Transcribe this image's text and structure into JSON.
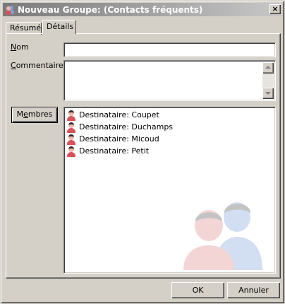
{
  "window": {
    "title": "Nouveau Groupe:  (Contacts fréquents)",
    "close_label": "×"
  },
  "tabs": [
    {
      "label": "Résumé"
    },
    {
      "label": "Détails"
    }
  ],
  "fields": {
    "nom": {
      "label_accel": "N",
      "label_rest": "om",
      "value": ""
    },
    "commentaires": {
      "label_accel": "C",
      "label_rest": "ommentaires",
      "value": ""
    }
  },
  "members": {
    "button_pre": "M",
    "button_accel": "e",
    "button_rest": "mbres",
    "items": [
      {
        "label": "Destinataire: Coupet"
      },
      {
        "label": "Destinataire: Duchamps"
      },
      {
        "label": "Destinataire: Micoud"
      },
      {
        "label": "Destinataire: Petit"
      }
    ]
  },
  "footer": {
    "ok_label": "OK",
    "cancel_label": "Annuler"
  },
  "icons": {
    "app": "group-icon",
    "member": "person-icon",
    "watermark": "group-watermark-icon"
  },
  "colors": {
    "person_body": "#d8505a",
    "person_head": "#f2b6a8",
    "watermark_blue": "#7fa3d8",
    "watermark_red": "#e08a8a"
  }
}
